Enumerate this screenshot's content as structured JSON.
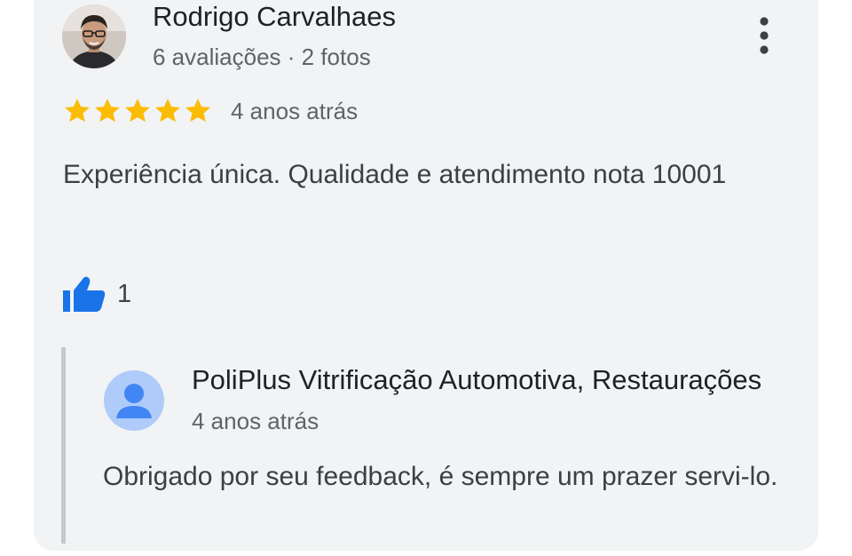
{
  "review": {
    "reviewer": {
      "name": "Rodrigo Carvalhaes",
      "meta": "6 avaliações · 2 fotos"
    },
    "rating": 5,
    "rating_max": 5,
    "date": "4 anos atrás",
    "text": "Experiência única. Qualidade e atendimento nota 10001",
    "likes": "1"
  },
  "reply": {
    "owner_name": "PoliPlus Vitrificação Automotiva, Restaurações",
    "date": "4 anos atrás",
    "text": "Obrigado por seu feedback, é sempre um prazer servi-lo."
  },
  "icons": {
    "more": "more-vert-icon",
    "star": "star-icon",
    "like": "thumbs-up-icon",
    "owner_avatar": "person-icon"
  },
  "colors": {
    "star": "#fbbc04",
    "like": "#1a73e8",
    "card_background": "#f1f3f4",
    "owner_avatar_bg": "#aecbfa",
    "owner_avatar_fg": "#4285f4"
  }
}
